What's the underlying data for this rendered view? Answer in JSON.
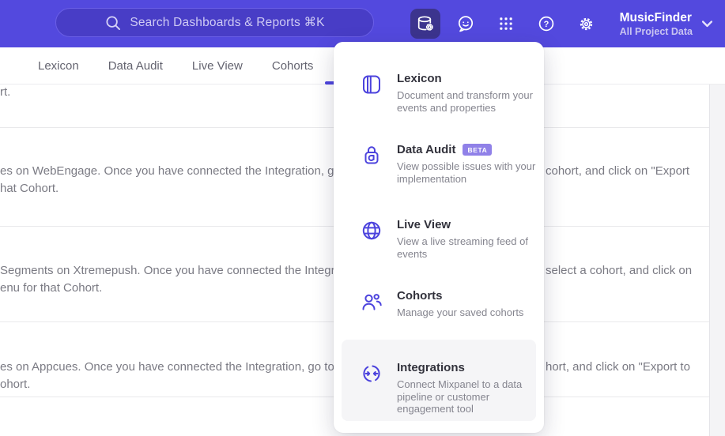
{
  "header": {
    "search": {
      "placeholder": "Search Dashboards & Reports ⌘K"
    },
    "project": {
      "name": "MusicFinder",
      "scope": "All Project Data"
    },
    "icons": [
      "data-management-icon",
      "feedback-icon",
      "apps-grid-icon",
      "help-icon",
      "settings-icon",
      "chevron-down-icon"
    ]
  },
  "tabs": [
    {
      "label": "Lexicon"
    },
    {
      "label": "Data Audit"
    },
    {
      "label": "Live View"
    },
    {
      "label": "Cohorts"
    }
  ],
  "menu": {
    "items": [
      {
        "title": "Lexicon",
        "icon": "book-icon",
        "description": "Document and transform your events and properties"
      },
      {
        "title": "Data Audit",
        "badge": "BETA",
        "icon": "lock-icon",
        "description": "View possible issues with your implementation"
      },
      {
        "title": "Live View",
        "icon": "globe-icon",
        "description": "View a live streaming feed of events"
      },
      {
        "title": "Cohorts",
        "icon": "people-icon",
        "description": "Manage your saved cohorts"
      },
      {
        "title": "Integrations",
        "icon": "sync-icon",
        "description": "Connect Mixpanel to a data pipeline or customer engagement tool",
        "highlighted": true
      }
    ]
  },
  "table": {
    "rows": [
      {
        "left_line1": "rt.",
        "left_line2": "",
        "right": ""
      },
      {
        "left_line1": "es on WebEngage. Once you have connected the Integration, go to the",
        "left_line2": "hat Cohort.",
        "right": "cohort, and click on \"Export"
      },
      {
        "left_line1": "Segments on Xtremepush. Once you have connected the Integration,",
        "left_line2": "enu for that Cohort.",
        "right": "select a cohort, and click on"
      },
      {
        "left_line1": "es on Appcues. Once you have connected the Integration, go to the M",
        "left_line2": "ohort.",
        "right": "hort, and click on \"Export to"
      },
      {
        "left_line1": "",
        "left_line2": "",
        "right": ""
      }
    ]
  },
  "colors": {
    "header_bg": "#5349de",
    "accent": "#4c43dd",
    "active_button_bg": "#3c348e",
    "badge_bg": "#9081e8",
    "highlight_bg": "#f5f5f7"
  }
}
